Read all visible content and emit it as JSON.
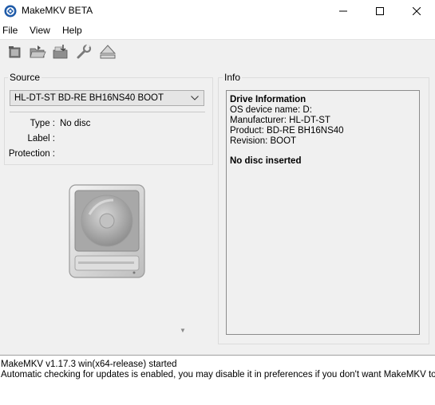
{
  "window": {
    "title": "MakeMKV BETA",
    "icon": "makemkv-app-icon"
  },
  "menu": {
    "items": [
      "File",
      "View",
      "Help"
    ]
  },
  "toolbar": {
    "buttons": [
      "open-disc-icon",
      "open-files-icon",
      "save-to-mkv-icon",
      "preferences-wrench-icon",
      "eject-icon"
    ]
  },
  "source": {
    "title": "Source",
    "selected_drive": "HL-DT-ST BD-RE  BH16NS40 BOOT",
    "fields": [
      {
        "label": "Type :",
        "value": "No disc"
      },
      {
        "label": "Label :",
        "value": ""
      },
      {
        "label": "Protection :",
        "value": ""
      }
    ]
  },
  "info": {
    "title": "Info",
    "heading": "Drive Information",
    "lines": [
      "OS device name: D:",
      "Manufacturer: HL-DT-ST",
      "Product: BD-RE BH16NS40",
      "Revision: BOOT"
    ],
    "status": "No disc inserted"
  },
  "log": {
    "lines": [
      "MakeMKV v1.17.3 win(x64-release) started",
      "Automatic checking for updates is enabled, you may disable it in preferences if you don't want MakeMKV to contact"
    ]
  },
  "colors": {
    "window_bg": "#f0f0f0",
    "accent": "#1e6fd9"
  }
}
